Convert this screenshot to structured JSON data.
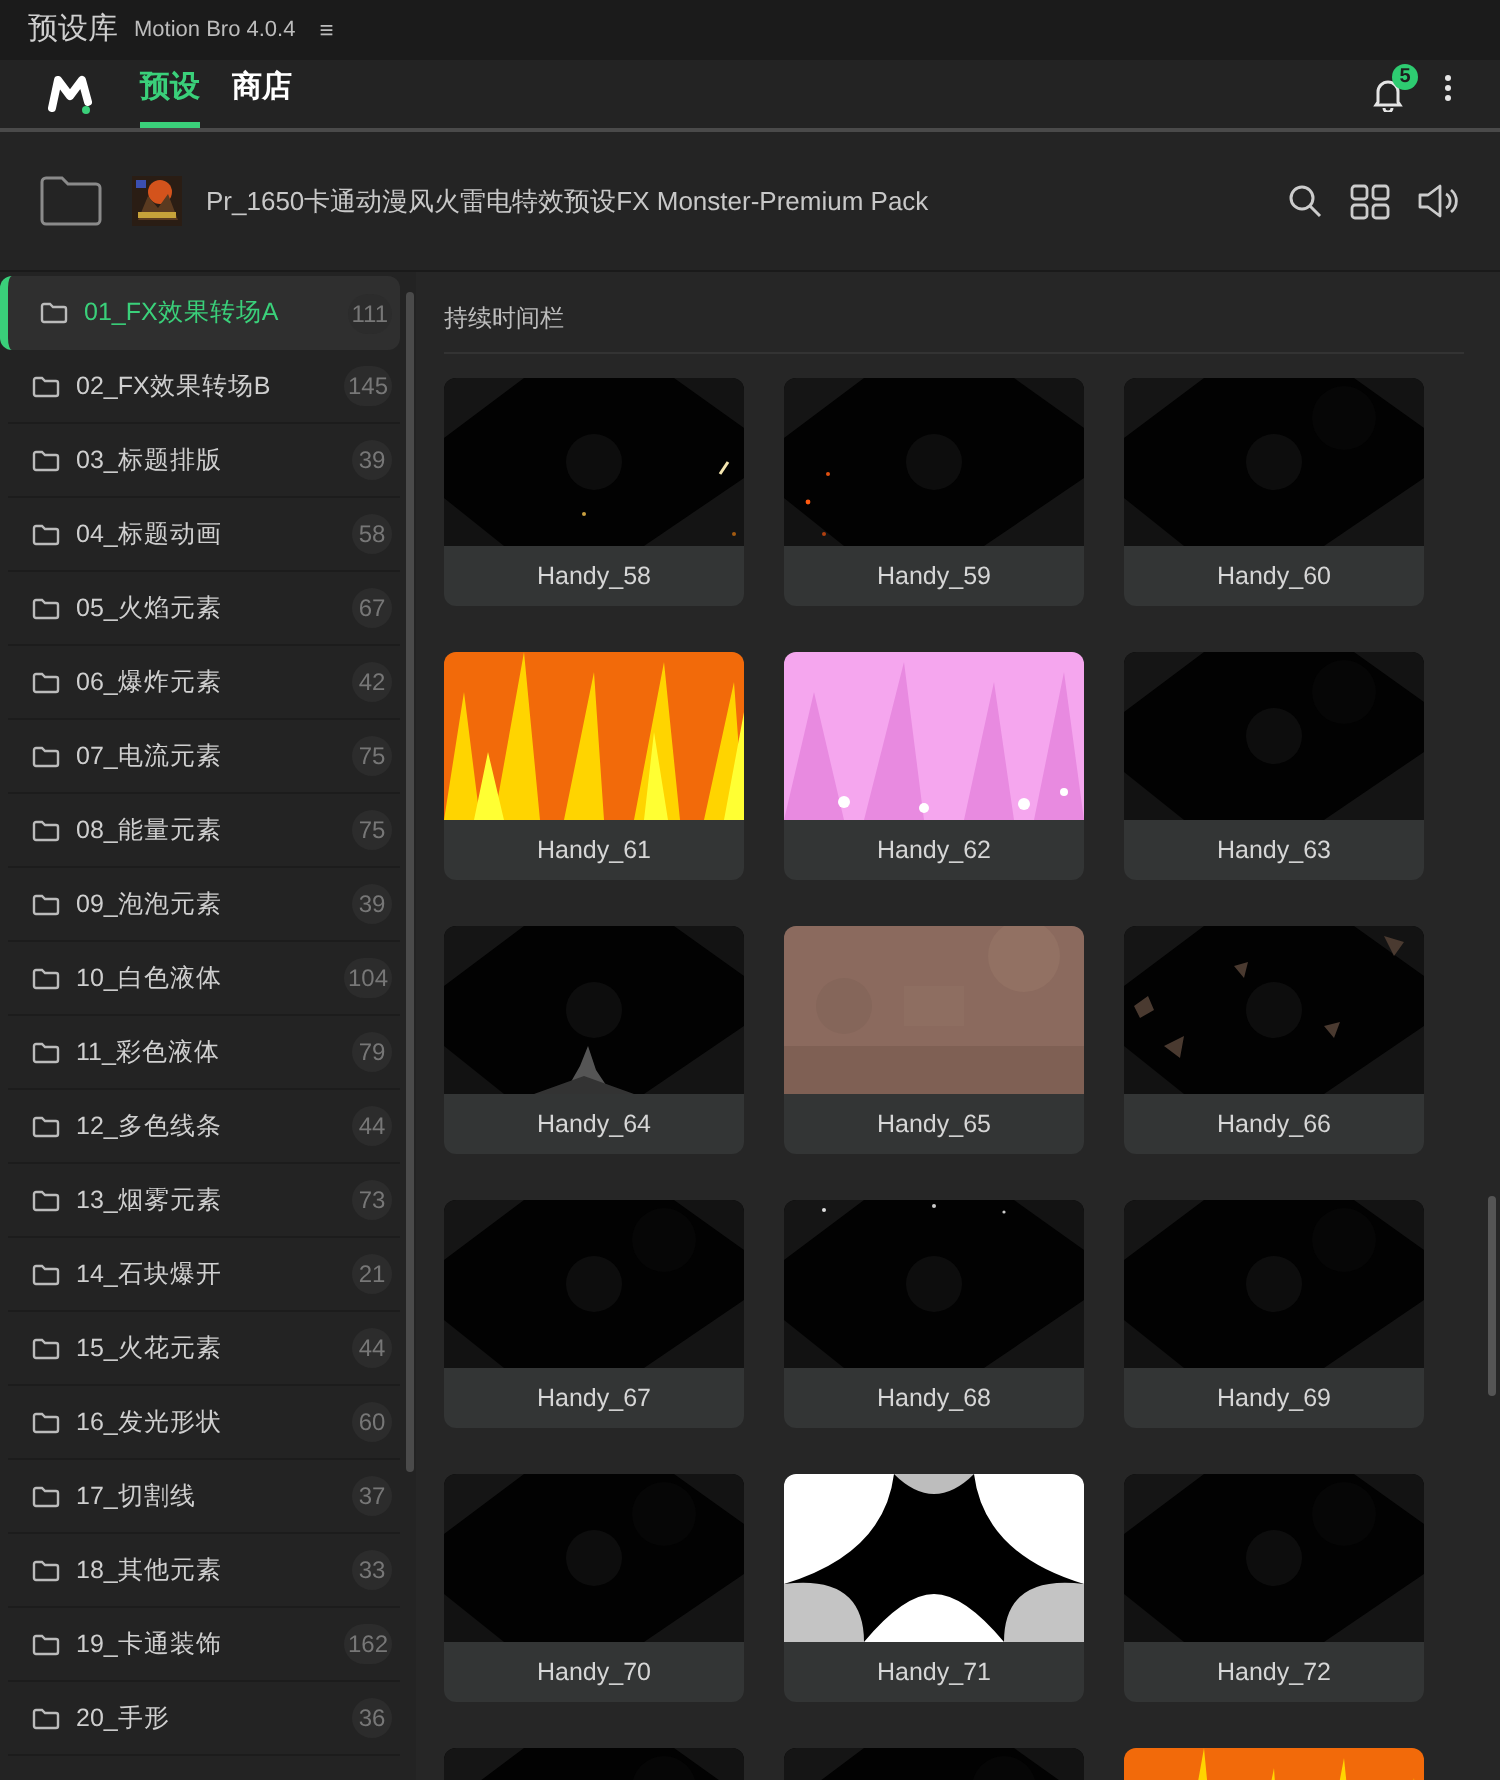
{
  "window": {
    "title": "预设库",
    "app": "Motion Bro 4.0.4",
    "menu_glyph": "≡"
  },
  "tabs": [
    {
      "label": "预设",
      "selected": true
    },
    {
      "label": "商店",
      "selected": false
    }
  ],
  "notifications": {
    "count": "5"
  },
  "pack": {
    "title": "Pr_1650卡通动漫风火雷电特效预设FX Monster-Premium Pack"
  },
  "sidebar": {
    "items": [
      {
        "label": "01_FX效果转场A",
        "count": "111",
        "selected": true
      },
      {
        "label": "02_FX效果转场B",
        "count": "145",
        "selected": false
      },
      {
        "label": "03_标题排版",
        "count": "39",
        "selected": false
      },
      {
        "label": "04_标题动画",
        "count": "58",
        "selected": false
      },
      {
        "label": "05_火焰元素",
        "count": "67",
        "selected": false
      },
      {
        "label": "06_爆炸元素",
        "count": "42",
        "selected": false
      },
      {
        "label": "07_电流元素",
        "count": "75",
        "selected": false
      },
      {
        "label": "08_能量元素",
        "count": "75",
        "selected": false
      },
      {
        "label": "09_泡泡元素",
        "count": "39",
        "selected": false
      },
      {
        "label": "10_白色液体",
        "count": "104",
        "selected": false
      },
      {
        "label": "11_彩色液体",
        "count": "79",
        "selected": false
      },
      {
        "label": "12_多色线条",
        "count": "44",
        "selected": false
      },
      {
        "label": "13_烟雾元素",
        "count": "73",
        "selected": false
      },
      {
        "label": "14_石块爆开",
        "count": "21",
        "selected": false
      },
      {
        "label": "15_火花元素",
        "count": "44",
        "selected": false
      },
      {
        "label": "16_发光形状",
        "count": "60",
        "selected": false
      },
      {
        "label": "17_切割线",
        "count": "37",
        "selected": false
      },
      {
        "label": "18_其他元素",
        "count": "33",
        "selected": false
      },
      {
        "label": "19_卡通装饰",
        "count": "162",
        "selected": false
      },
      {
        "label": "20_手形",
        "count": "36",
        "selected": false
      }
    ]
  },
  "section": {
    "title": "持续时间栏"
  },
  "presets": [
    {
      "label": "Handy_58"
    },
    {
      "label": "Handy_59"
    },
    {
      "label": "Handy_60"
    },
    {
      "label": "Handy_61"
    },
    {
      "label": "Handy_62"
    },
    {
      "label": "Handy_63"
    },
    {
      "label": "Handy_64"
    },
    {
      "label": "Handy_65"
    },
    {
      "label": "Handy_66"
    },
    {
      "label": "Handy_67"
    },
    {
      "label": "Handy_68"
    },
    {
      "label": "Handy_69"
    },
    {
      "label": "Handy_70"
    },
    {
      "label": "Handy_71"
    },
    {
      "label": "Handy_72"
    },
    {
      "kind": "picture"
    },
    {
      "kind": "picture"
    },
    {
      "kind": "picture"
    }
  ]
}
